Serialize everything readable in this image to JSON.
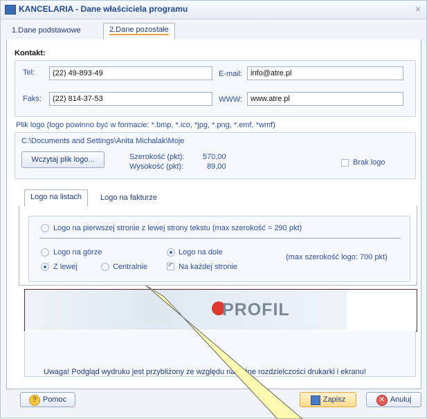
{
  "window": {
    "title": "KANCELARIA - Dane właściciela programu",
    "close_glyph": "×"
  },
  "tabs": [
    {
      "label": "1.Dane podstawowe"
    },
    {
      "label": "2.Dane pozostałe"
    }
  ],
  "contact": {
    "section_label": "Kontakt:",
    "tel_label": "Tel:",
    "tel_value": "(22) 49-893-49",
    "email_label": "E-mail:",
    "email_value": "info@atre.pl",
    "fax_label": "Faks:",
    "fax_value": "(22) 814-37-53",
    "www_label": "WWW:",
    "www_value": "www.atre.pl"
  },
  "logo_file": {
    "hint": "Plik logo (logo powinno być w formacie: *.bmp, *.ico, *jpg, *.png, *.emf, *wmf)",
    "path": "C:\\Documents and Settings\\Anita Michalak\\Moje",
    "load_button": "Wczytaj plik logo...",
    "width_label": "Szerokość (pkt):",
    "width_value": "570,00",
    "height_label": "Wysokość (pkt):",
    "height_value": "89,00",
    "no_logo_label": "Brak logo"
  },
  "subtabs": [
    {
      "label": "Logo na listach"
    },
    {
      "label": "Logo na fakturze"
    }
  ],
  "options": {
    "first_page": "Logo na pierwszej stronie z lewej strony tekstu (max szerokość = 290 pkt)",
    "top": "Logo na górze",
    "bottom": "Logo na dole",
    "left": "Z lewej",
    "center": "Centralnie",
    "every_page": "Na każdej stronie",
    "max_width_note": "(max szerokość logo: 700 pkt)"
  },
  "preview": {
    "logo_text": "PROFIL"
  },
  "warning": "Uwaga! Podgląd wydruku jest przybliżony ze względu na różne rozdzielczości drukarki i ekranu!",
  "buttons": {
    "help": "Pomoc",
    "save": "Zapisz",
    "cancel": "Anuluj"
  }
}
